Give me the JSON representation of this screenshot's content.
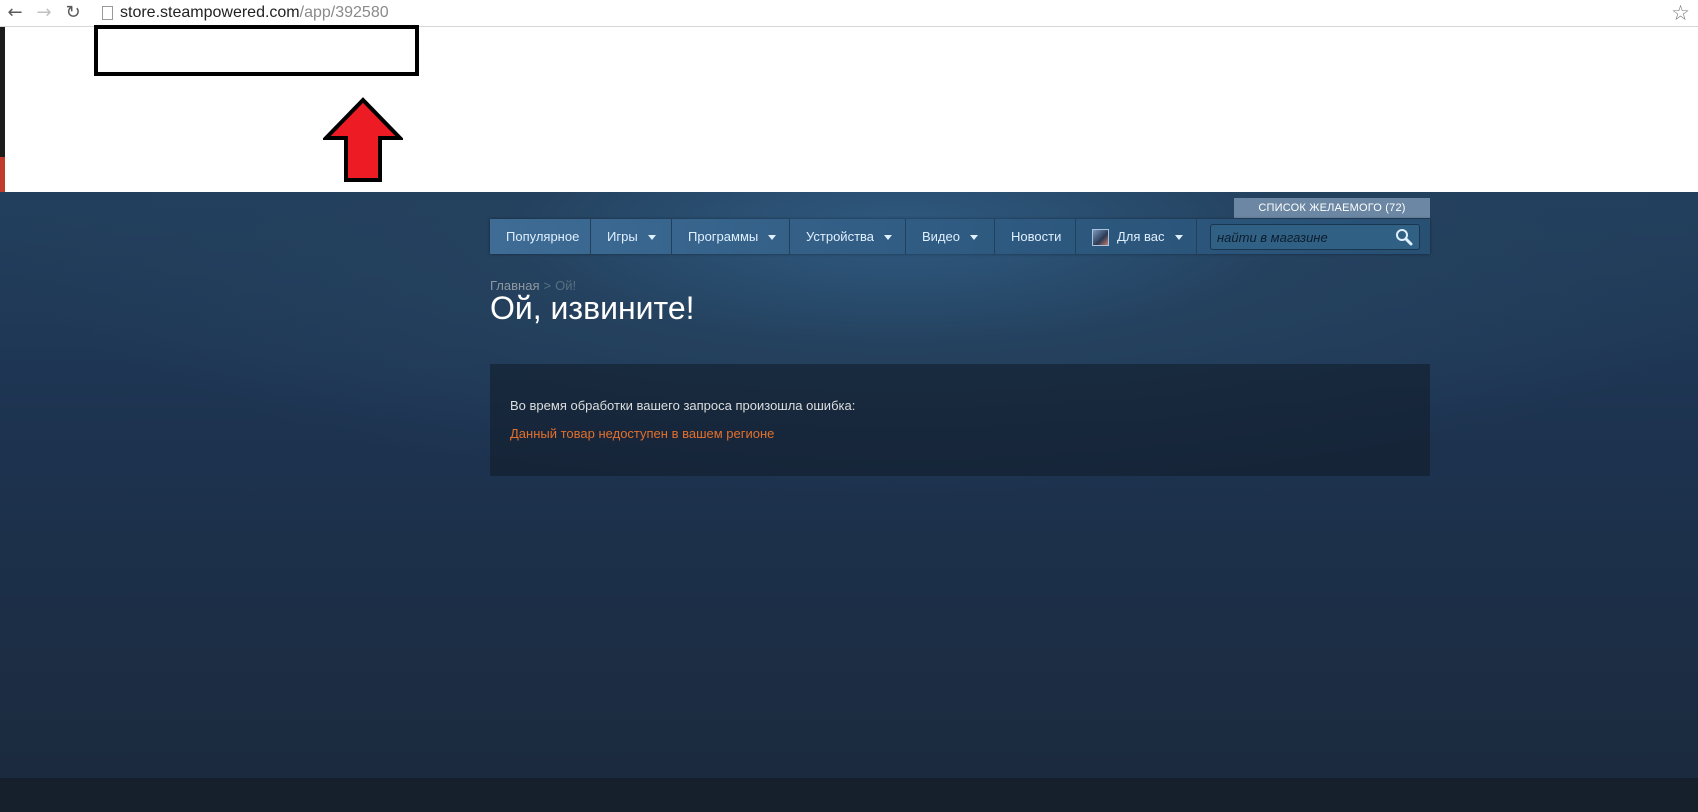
{
  "browser": {
    "url_host": "store.steampowered.com",
    "url_path": "/app/392580",
    "back_icon": "back-arrow-icon",
    "forward_icon": "forward-arrow-icon",
    "reload_icon": "reload-icon",
    "bookmark_icon": "star-icon"
  },
  "annotation": {
    "highlight_color": "#000000",
    "arrow_color": "#ed1c24"
  },
  "store": {
    "wishlist_label": "СПИСОК ЖЕЛАЕМОГО (72)",
    "nav": {
      "popular": "Популярное",
      "games": "Игры",
      "software": "Программы",
      "hardware": "Устройства",
      "video": "Видео",
      "news": "Новости",
      "for_you": "Для вас"
    },
    "search": {
      "placeholder": "найти в магазине",
      "value": ""
    },
    "breadcrumb": {
      "home": "Главная",
      "separator": ">",
      "current": "Ой!"
    },
    "title": "Ой, извините!",
    "error": {
      "message": "Во время обработки вашего запроса произошла ошибка:",
      "reason": "Данный товар недоступен в вашем регионе"
    },
    "colors": {
      "background": "#1b2838",
      "nav": "#3e6c95",
      "error_reason": "#e36f2b"
    }
  }
}
